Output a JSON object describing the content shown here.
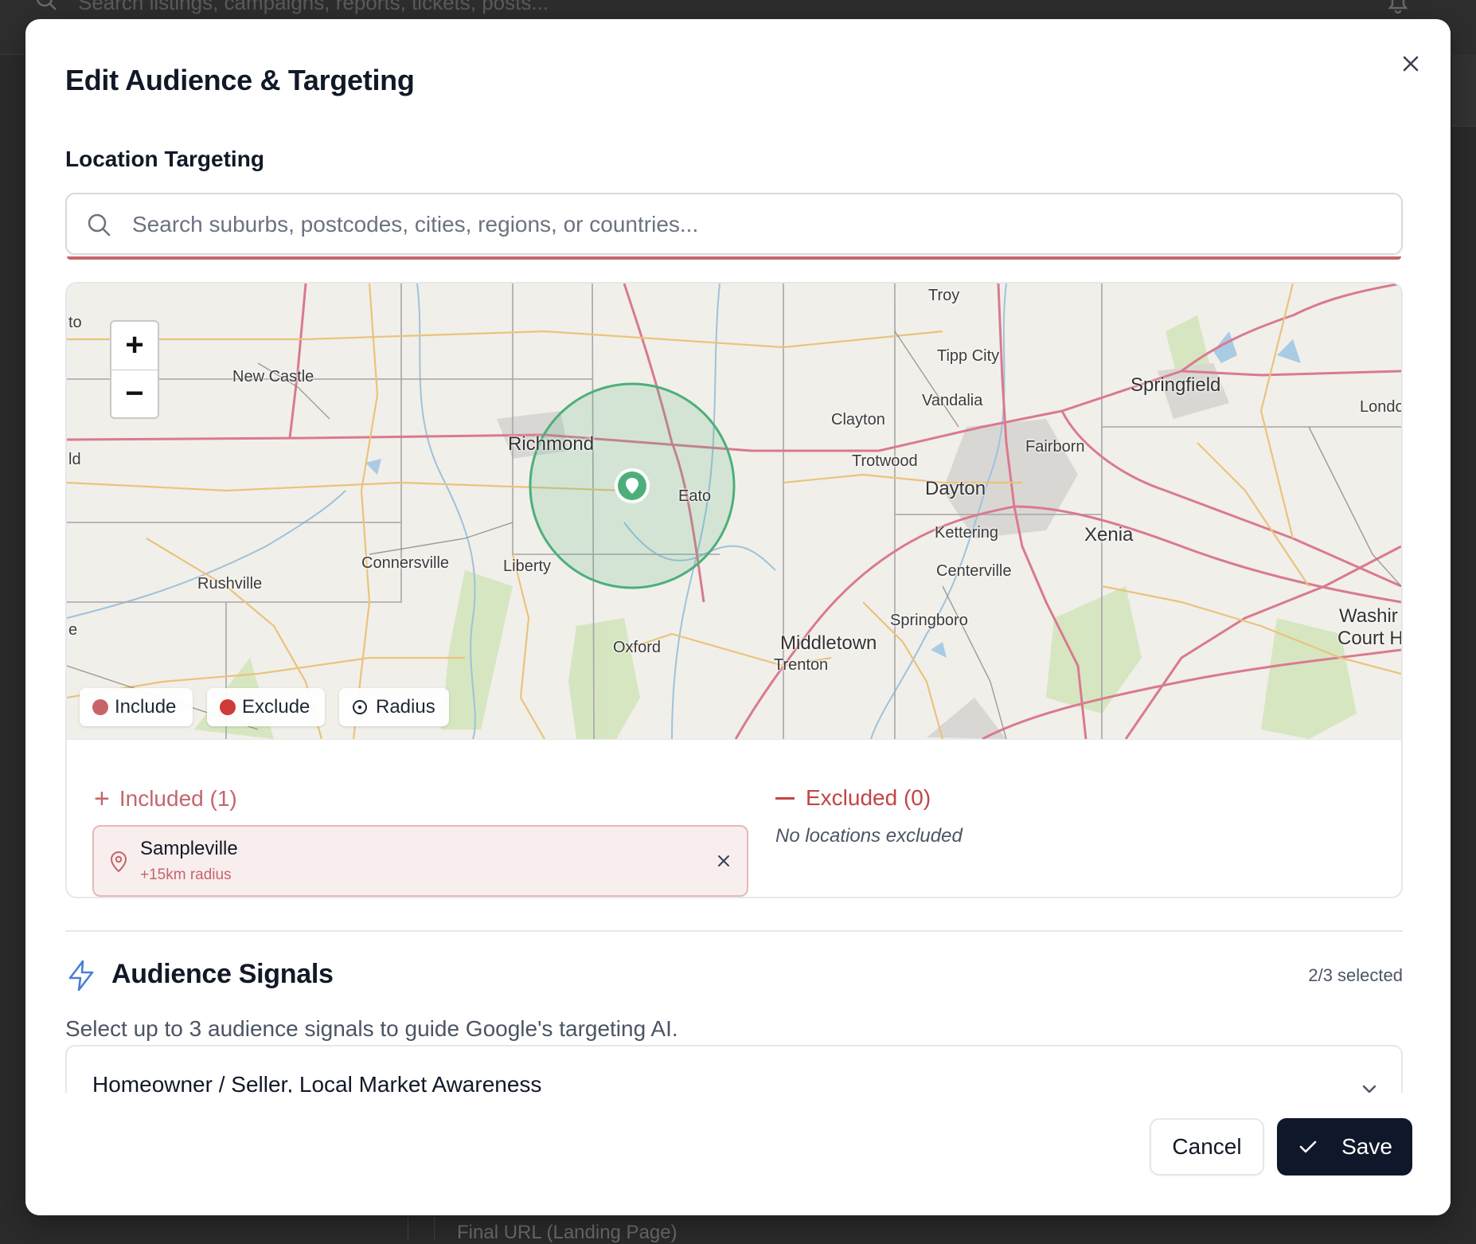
{
  "background": {
    "search_placeholder": "Search listings, campaigns, reports, tickets, posts...",
    "bottom_label": "Final URL (Landing Page)"
  },
  "modal": {
    "title": "Edit Audience & Targeting"
  },
  "location": {
    "section_label": "Location Targeting",
    "search_placeholder": "Search suburbs, postcodes, cities, regions, or countries...",
    "search_value": "",
    "map": {
      "zoom_in": "+",
      "zoom_out": "−",
      "labels": [
        "Troy",
        "Tipp City",
        "Springfield",
        "Vandalia",
        "Clayton",
        "Fairborn",
        "Richmond",
        "New Castle",
        "Trotwood",
        "Dayton",
        "Eato",
        "Kettering",
        "Xenia",
        "Centerville",
        "Connersville",
        "Liberty",
        "Rushville",
        "Springboro",
        "Washir",
        "Court H",
        "Oxford",
        "Middletown",
        "Trenton",
        "Londo",
        "to",
        "ld",
        "e"
      ],
      "chips": {
        "include": "Include",
        "exclude": "Exclude",
        "radius": "Radius"
      }
    },
    "included": {
      "heading": "Included (1)",
      "items": [
        {
          "name": "Sampleville",
          "detail": "+15km radius"
        }
      ]
    },
    "excluded": {
      "heading": "Excluded (0)",
      "empty_text": "No locations excluded"
    }
  },
  "audience": {
    "title": "Audience Signals",
    "count": "2/3 selected",
    "description": "Select up to 3 audience signals to guide Google's targeting AI.",
    "selected_value": "Homeowner / Seller, Local Market Awareness"
  },
  "footer": {
    "cancel_label": "Cancel",
    "save_label": "Save"
  },
  "colors": {
    "include": "#c5656b",
    "exclude": "#c24545",
    "radius_circle": "#4caf7a",
    "primary_button": "#0f172a"
  }
}
